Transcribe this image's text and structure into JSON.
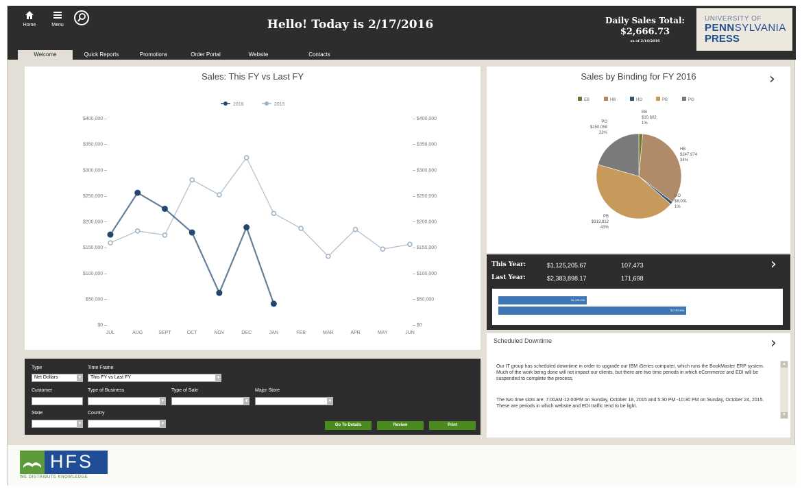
{
  "header": {
    "home_label": "Home",
    "menu_label": "Menu",
    "greeting": "Hello! Today is 2/17/2016",
    "daily_sales_title": "Daily Sales Total:",
    "daily_sales_value": "$2,666.73",
    "daily_sales_asof": "as of 2/16/2016",
    "logo_line1": "UNIVERSITY OF",
    "logo_line2_bold": "PENN",
    "logo_line2_rest": "SYLVANIA",
    "logo_line3": "PRESS"
  },
  "tabs": [
    {
      "label": "Welcome",
      "active": true
    },
    {
      "label": "Quick Reports",
      "active": false
    },
    {
      "label": "Promotions",
      "active": false
    },
    {
      "label": "Order Portal",
      "active": false
    },
    {
      "label": "Website",
      "active": false
    },
    {
      "label": "Contacts",
      "active": false
    }
  ],
  "line_chart": {
    "title": "Sales: This FY vs Last FY",
    "legend": [
      "2016",
      "2015"
    ],
    "y_ticks": [
      "$0",
      "$50,000",
      "$100,000",
      "$150,000",
      "$200,000",
      "$250,000",
      "$300,000",
      "$350,000",
      "$400,000"
    ],
    "x_ticks": [
      "JUL",
      "AUG",
      "SEPT",
      "OCT",
      "NOV",
      "DEC",
      "JAN",
      "FEB",
      "MAR",
      "APR",
      "MAY",
      "JUN"
    ]
  },
  "pie_chart": {
    "title": "Sales by Binding for FY 2016",
    "legend": [
      "EB",
      "HB",
      "HO",
      "PB",
      "PO"
    ],
    "labels": {
      "EB": [
        "EB",
        "$10,602",
        "1%"
      ],
      "PO": [
        "PO",
        "$150,058",
        "22%"
      ],
      "HB": [
        "HB",
        "$247,974",
        "34%"
      ],
      "HO": [
        "HO",
        "$8,001",
        "1%"
      ],
      "PB": [
        "PB",
        "$313,812",
        "43%"
      ]
    }
  },
  "year_summary": {
    "this_year_label": "This Year:",
    "this_year_amount": "$1,125,205.67",
    "this_year_units": "107,473",
    "last_year_label": "Last Year:",
    "last_year_amount": "$2,383,898.17",
    "last_year_units": "171,698",
    "bar_this_label": "$1,125,206",
    "bar_last_label": "$2,383,898",
    "bar_this_fraction": 0.472,
    "bar_last_fraction": 1.0
  },
  "downtime": {
    "title": "Scheduled Downtime",
    "paragraph1": "Our IT group has scheduled downtime in order to upgrade our IBM iSeries computer, which runs the BookMaster ERP system. Much of the work being done will not impact our clients, but there are two time periods in which eCommerce and EDI will be suspended to complete the process.",
    "paragraph2": "The two time slots are: 7:00AM-12:00PM on Sunday, October 18, 2015 and 5:30 PM -10:30 PM on Sunday, October 24, 2015. These are periods in which website and EDI traffic tend to be light."
  },
  "filters": {
    "type_label": "Type",
    "type_value": "Net Dollars",
    "timeframe_label": "Time Frame",
    "timeframe_value": "This FY vs Last FY",
    "customer_label": "Customer",
    "type_of_business_label": "Type of Business",
    "type_of_sale_label": "Type of Sale",
    "major_store_label": "Major Store",
    "state_label": "State",
    "country_label": "Country",
    "go_to_details": "Go To Details",
    "review": "Review",
    "print": "Print"
  },
  "footer": {
    "logo_text": "HFS",
    "tagline": "WE DISTRIBUTE KNOWLEDGE"
  },
  "colors": {
    "header_bg": "#2d2d2d",
    "series_2016": "#24476f",
    "series_2015": "#9fb3c4",
    "button_green": "#4b8a1e",
    "bar_blue": "#3f76b5",
    "pie_EB": "#6e7a2a",
    "pie_HB": "#b08b6a",
    "pie_HO": "#2f5878",
    "pie_PB": "#c79a5c",
    "pie_PO": "#7a7a7a"
  },
  "chart_data": [
    {
      "type": "line",
      "title": "Sales: This FY vs Last FY",
      "categories": [
        "JUL",
        "AUG",
        "SEPT",
        "OCT",
        "NOV",
        "DEC",
        "JAN",
        "FEB",
        "MAR",
        "APR",
        "MAY",
        "JUN"
      ],
      "series": [
        {
          "name": "2016",
          "values": [
            174000,
            255000,
            224000,
            178000,
            61000,
            188000,
            40000,
            null,
            null,
            null,
            null,
            null
          ]
        },
        {
          "name": "2015",
          "values": [
            158000,
            181000,
            173000,
            280000,
            251000,
            323000,
            215000,
            186000,
            132000,
            184000,
            146000,
            155000
          ]
        }
      ],
      "ylim": [
        0,
        400000
      ],
      "grid": false,
      "legend": "top"
    },
    {
      "type": "pie",
      "title": "Sales by Binding for FY 2016",
      "categories": [
        "EB",
        "HB",
        "HO",
        "PB",
        "PO"
      ],
      "values": [
        10602,
        247974,
        8001,
        313812,
        150058
      ],
      "percent_labels": [
        "1%",
        "34%",
        "1%",
        "43%",
        "22%"
      ],
      "legend": "top"
    }
  ]
}
